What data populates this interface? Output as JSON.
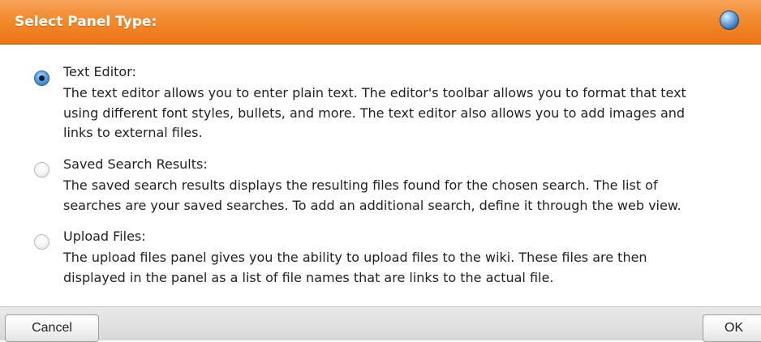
{
  "dialog": {
    "title": "Select Panel Type:",
    "help_icon": "help-globe-icon"
  },
  "options": [
    {
      "label": "Text Editor:",
      "selected": true,
      "description_lines": [
        "The text editor allows you to enter plain text. The editor's toolbar allows you to format that text",
        "using different font styles, bullets, and more. The text editor also allows you to add images and",
        "links to external files."
      ]
    },
    {
      "label": "Saved Search Results:",
      "selected": false,
      "description_lines": [
        "The saved search results displays the resulting files found for the chosen search. The list of",
        "searches are your saved searches. To add an additional search, define it through the web view."
      ]
    },
    {
      "label": "Upload Files:",
      "selected": false,
      "description_lines": [
        "The upload files panel gives you the ability to upload files to the wiki. These files are then",
        "displayed in the panel as a list of file names that are links to the actual file."
      ]
    }
  ],
  "footer": {
    "cancel_label": "Cancel",
    "ok_label": "OK"
  },
  "colors": {
    "titlebar": "#f28a2e",
    "radio_selected": "#2b6cb7"
  }
}
